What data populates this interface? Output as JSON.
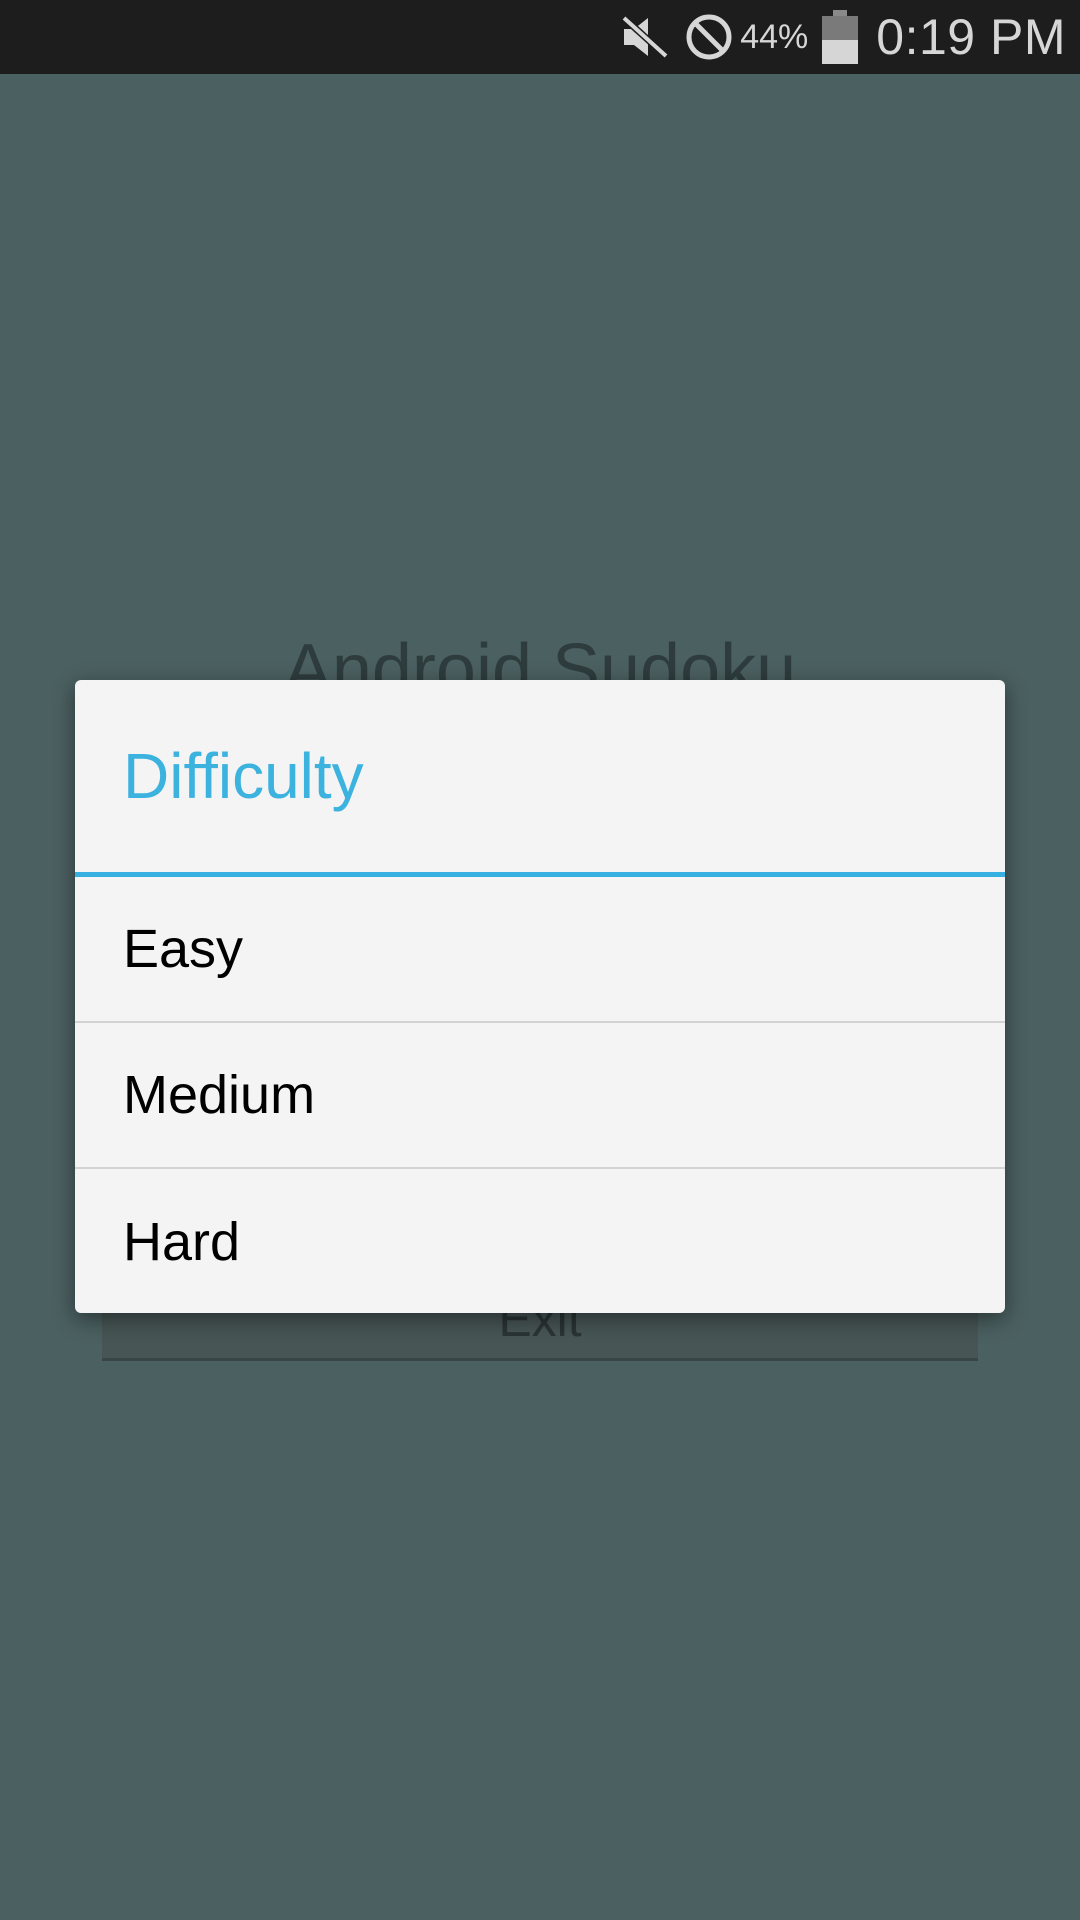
{
  "status_bar": {
    "battery_percent": "44%",
    "time": "0:19 PM",
    "icons": [
      "mute-icon",
      "blocked-icon",
      "battery-icon"
    ]
  },
  "background_screen": {
    "app_title": "Android Sudoku",
    "exit_label": "Exit"
  },
  "dialog": {
    "title": "Difficulty",
    "options": [
      "Easy",
      "Medium",
      "Hard"
    ]
  },
  "colors": {
    "accent": "#33b5e5",
    "dialog_bg": "#f4f4f4",
    "scrim_bg": "#4b6061",
    "status_bar_bg": "#1d1d1d"
  }
}
